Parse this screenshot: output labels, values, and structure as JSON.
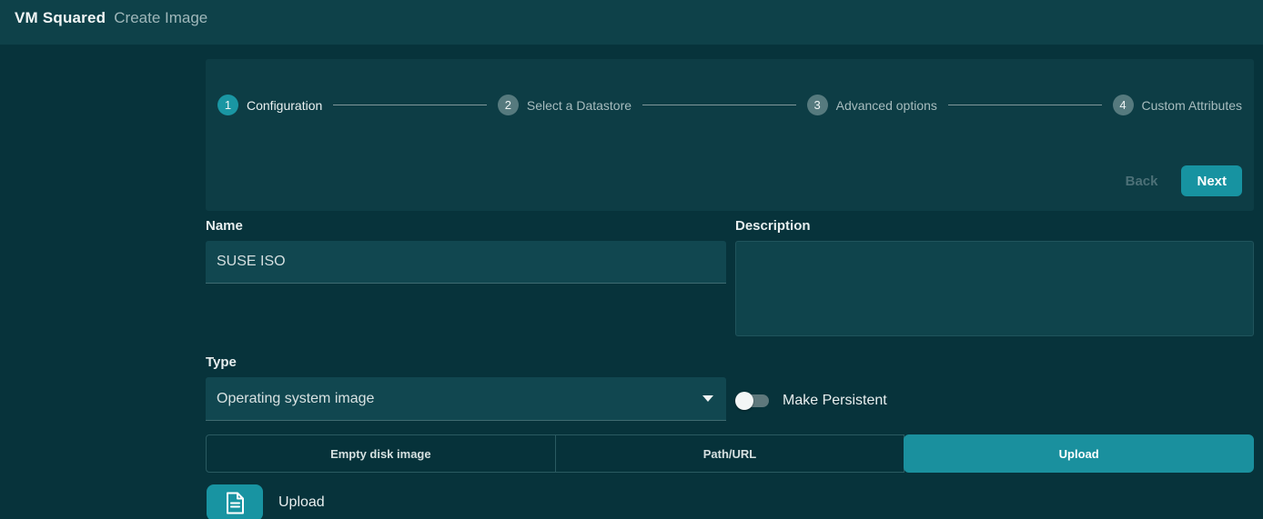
{
  "header": {
    "brand": "VM Squared",
    "page_title": "Create Image"
  },
  "stepper": {
    "steps": [
      {
        "number": "1",
        "label": "Configuration",
        "active": true
      },
      {
        "number": "2",
        "label": "Select a Datastore",
        "active": false
      },
      {
        "number": "3",
        "label": "Advanced options",
        "active": false
      },
      {
        "number": "4",
        "label": "Custom Attributes",
        "active": false
      }
    ],
    "back_label": "Back",
    "next_label": "Next"
  },
  "form": {
    "name": {
      "label": "Name",
      "value": "SUSE ISO"
    },
    "description": {
      "label": "Description",
      "value": ""
    },
    "type": {
      "label": "Type",
      "selected": "Operating system image"
    },
    "persistent": {
      "label": "Make Persistent",
      "enabled": false
    },
    "source_tabs": [
      {
        "label": "Empty disk image",
        "active": false
      },
      {
        "label": "Path/URL",
        "active": false
      },
      {
        "label": "Upload",
        "active": true
      }
    ],
    "upload": {
      "label": "Upload",
      "icon": "file-icon"
    }
  },
  "colors": {
    "page_bg": "#07333b",
    "header_bg": "#0e4149",
    "card_bg": "#0d3d45",
    "input_bg": "#114750",
    "accent_teal": "#1894a2",
    "inactive_step": "#567a7e",
    "connector": "#80989a",
    "tab_border": "#2a5a61"
  }
}
